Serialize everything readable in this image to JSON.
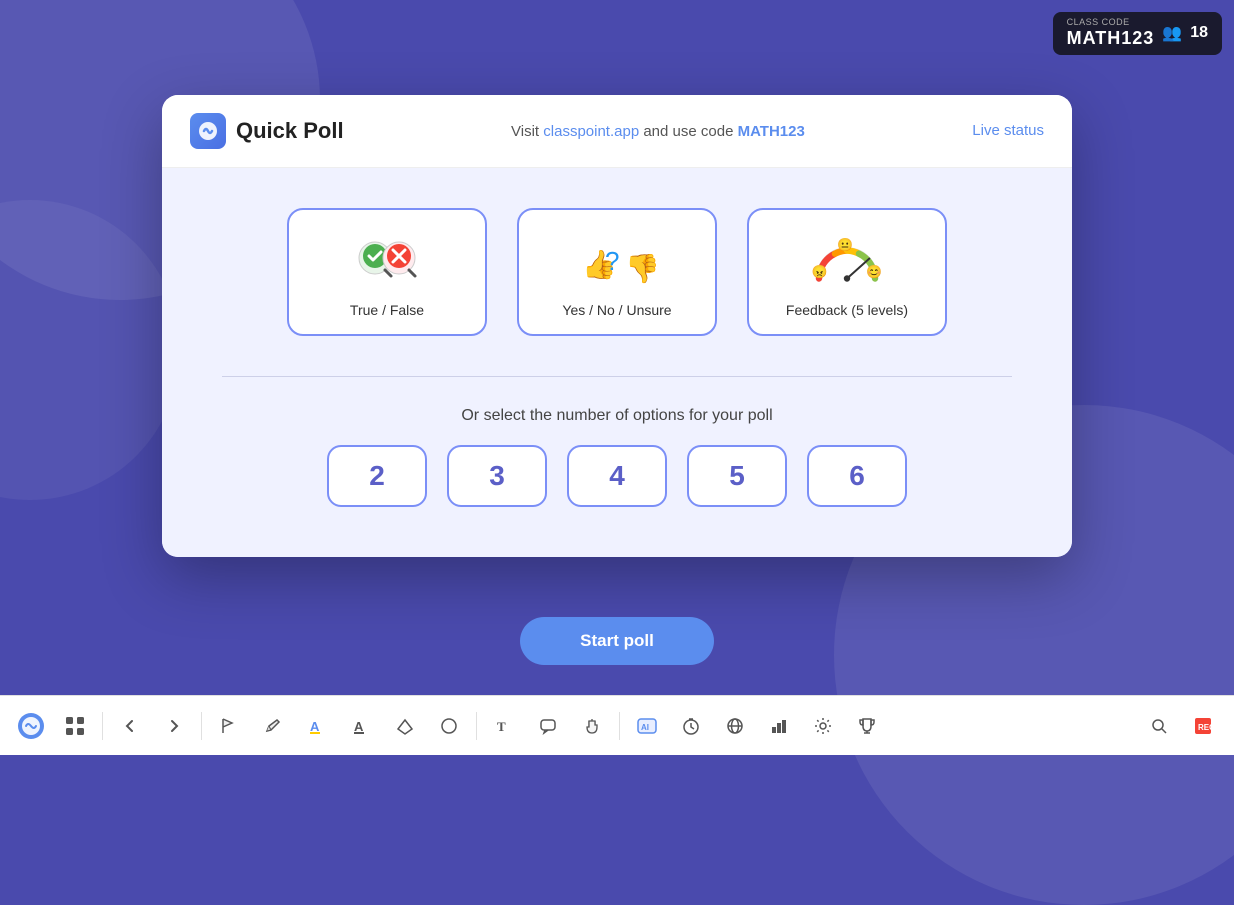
{
  "background": {
    "color": "#4a4aad"
  },
  "class_badge": {
    "label": "class\ncode",
    "code": "MATH123",
    "students_count": "18"
  },
  "modal": {
    "header": {
      "app_icon_letter": "C",
      "title": "Quick Poll",
      "visit_text": "Visit",
      "visit_link": "classpoint.app",
      "and_code_text": "and use code",
      "code": "MATH123",
      "live_status": "Live status"
    },
    "poll_types": [
      {
        "id": "true-false",
        "label": "True / False",
        "emoji": "✅❌"
      },
      {
        "id": "yes-no-unsure",
        "label": "Yes / No / Unsure",
        "emoji": "👍❓👎"
      },
      {
        "id": "feedback",
        "label": "Feedback (5 levels)",
        "emoji": "😠😐😊"
      }
    ],
    "number_section_label": "Or select the number of options for your poll",
    "number_options": [
      "2",
      "3",
      "4",
      "5",
      "6"
    ],
    "start_poll_label": "Start poll"
  },
  "toolbar": {
    "items": [
      {
        "id": "classpoint",
        "icon": "C",
        "label": "ClassPoint"
      },
      {
        "id": "grid",
        "icon": "⊞",
        "label": "Grid"
      },
      {
        "id": "back",
        "icon": "←",
        "label": "Back"
      },
      {
        "id": "forward",
        "icon": "→",
        "label": "Forward"
      },
      {
        "id": "flag",
        "icon": "⚑",
        "label": "Flag"
      },
      {
        "id": "pen",
        "icon": "✏",
        "label": "Pen"
      },
      {
        "id": "highlight",
        "icon": "A",
        "label": "Highlight A"
      },
      {
        "id": "highlight2",
        "icon": "A",
        "label": "Highlight A2"
      },
      {
        "id": "eraser",
        "icon": "◇",
        "label": "Eraser"
      },
      {
        "id": "shapes",
        "icon": "○",
        "label": "Shapes"
      },
      {
        "id": "text",
        "icon": "T",
        "label": "Text"
      },
      {
        "id": "bubble",
        "icon": "💬",
        "label": "Bubble"
      },
      {
        "id": "gesture",
        "icon": "✋",
        "label": "Gesture"
      },
      {
        "id": "ai",
        "icon": "AI",
        "label": "AI"
      },
      {
        "id": "timer",
        "icon": "⏰",
        "label": "Timer"
      },
      {
        "id": "globe",
        "icon": "🌐",
        "label": "Globe"
      },
      {
        "id": "chart",
        "icon": "📊",
        "label": "Chart"
      },
      {
        "id": "settings",
        "icon": "⚙",
        "label": "Settings"
      },
      {
        "id": "trophy",
        "icon": "🏆",
        "label": "Trophy"
      },
      {
        "id": "search",
        "icon": "🔍",
        "label": "Search"
      },
      {
        "id": "stop",
        "icon": "⬛",
        "label": "Stop"
      }
    ]
  }
}
